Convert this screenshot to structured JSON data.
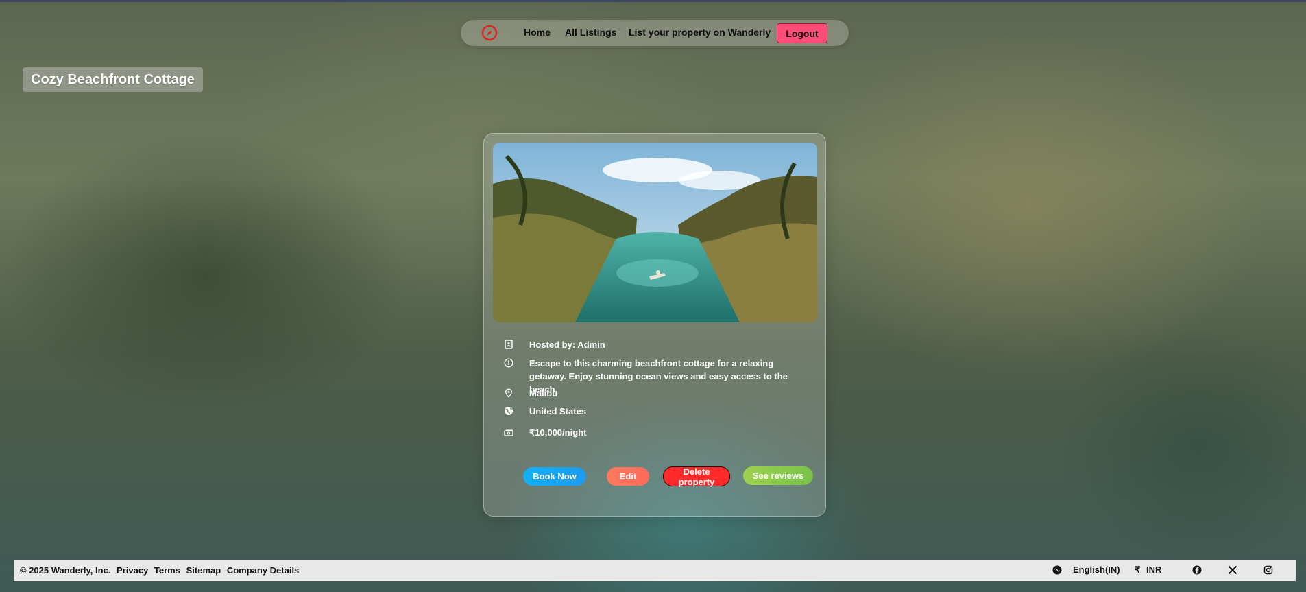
{
  "nav": {
    "logo_icon": "compass-icon",
    "links": [
      "Home",
      "All Listings",
      "List your property on Wanderly"
    ],
    "logout_label": "Logout"
  },
  "listing": {
    "title": "Cozy Beachfront Cottage",
    "image_alt": "Turquoise river lined with palm trees",
    "hosted_by": "Hosted by: Admin",
    "description": "Escape to this charming beachfront cottage for a relaxing getaway. Enjoy stunning ocean views and easy access to the beach.",
    "location": "Malibu",
    "country": "United States",
    "price": "₹10,000/night"
  },
  "actions": {
    "book": "Book Now",
    "edit": "Edit",
    "delete": "Delete property",
    "reviews": "See reviews"
  },
  "footer": {
    "copyright": "© 2025 Wanderly, Inc.",
    "links": [
      "Privacy",
      "Terms",
      "Sitemap",
      "Company Details"
    ],
    "language": "English(IN)",
    "currency_symbol": "₹",
    "currency": "INR",
    "social_icons": [
      "facebook-icon",
      "x-icon",
      "instagram-icon"
    ]
  },
  "colors": {
    "logout": "#ff4d78",
    "book": "#12b0f5",
    "edit": "#ff7a5c",
    "delete": "#ff2a2a",
    "reviews": "#8fd44f"
  }
}
